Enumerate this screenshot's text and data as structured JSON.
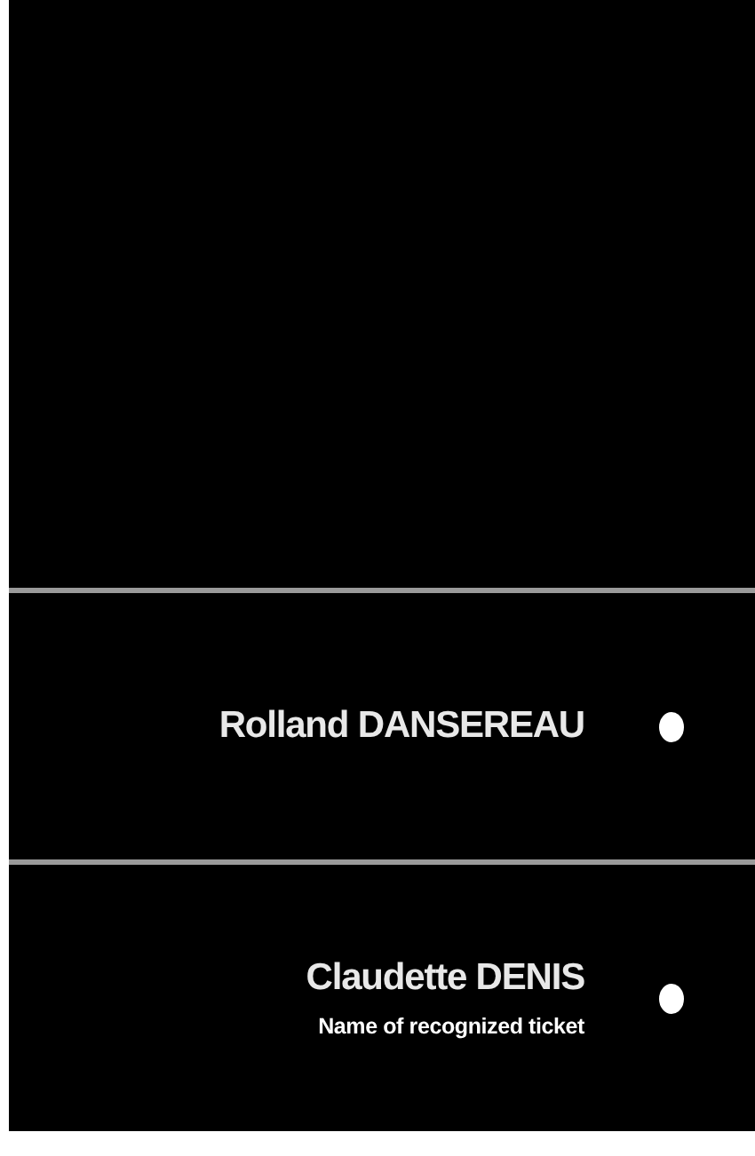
{
  "entries": [
    {
      "name": "Rolland DANSEREAU"
    },
    {
      "name": "Claudette DENIS",
      "caption": "Name of recognized ticket"
    }
  ]
}
